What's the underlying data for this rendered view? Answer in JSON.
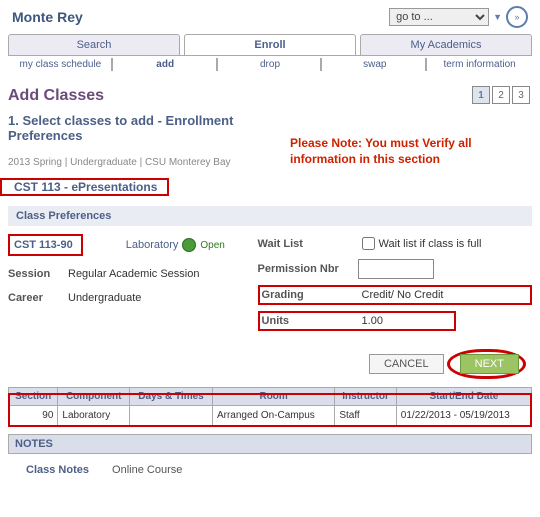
{
  "user": "Monte Rey",
  "goto": {
    "placeholder": "go to ...",
    "go_icon": "»"
  },
  "tabs": {
    "search": "Search",
    "enroll": "Enroll",
    "academics": "My Academics"
  },
  "subtabs": {
    "schedule": "my class schedule",
    "add": "add",
    "drop": "drop",
    "swap": "swap",
    "term": "term information"
  },
  "page_title": "Add Classes",
  "steps": [
    "1",
    "2",
    "3"
  ],
  "subtitle": "1.  Select classes to add - Enrollment Preferences",
  "note": "Please Note: You must Verify all information in this section",
  "crumbs": "2013 Spring | Undergraduate | CSU Monterey Bay",
  "course": "CST  113 - ePresentations",
  "prefs_header": "Class Preferences",
  "class_number": "CST 113-90",
  "component_label": "Laboratory",
  "status_label": "Open",
  "session": {
    "label": "Session",
    "value": "Regular Academic Session"
  },
  "career": {
    "label": "Career",
    "value": "Undergraduate"
  },
  "waitlist": {
    "label": "Wait List",
    "checkbox_label": "Wait list if class is full"
  },
  "permission": {
    "label": "Permission Nbr",
    "value": ""
  },
  "grading": {
    "label": "Grading",
    "value": "Credit/ No Credit"
  },
  "units": {
    "label": "Units",
    "value": "1.00"
  },
  "buttons": {
    "cancel": "CANCEL",
    "next": "NEXT"
  },
  "table": {
    "headers": {
      "section": "Section",
      "component": "Component",
      "days": "Days & Times",
      "room": "Room",
      "instructor": "Instructor",
      "dates": "Start/End Date"
    },
    "row": {
      "section": "90",
      "component": "Laboratory",
      "days": "",
      "room": "Arranged On-Campus",
      "instructor": "Staff",
      "dates": "01/22/2013 - 05/19/2013"
    }
  },
  "notes": {
    "header": "NOTES",
    "label": "Class Notes",
    "text": "Online Course"
  }
}
